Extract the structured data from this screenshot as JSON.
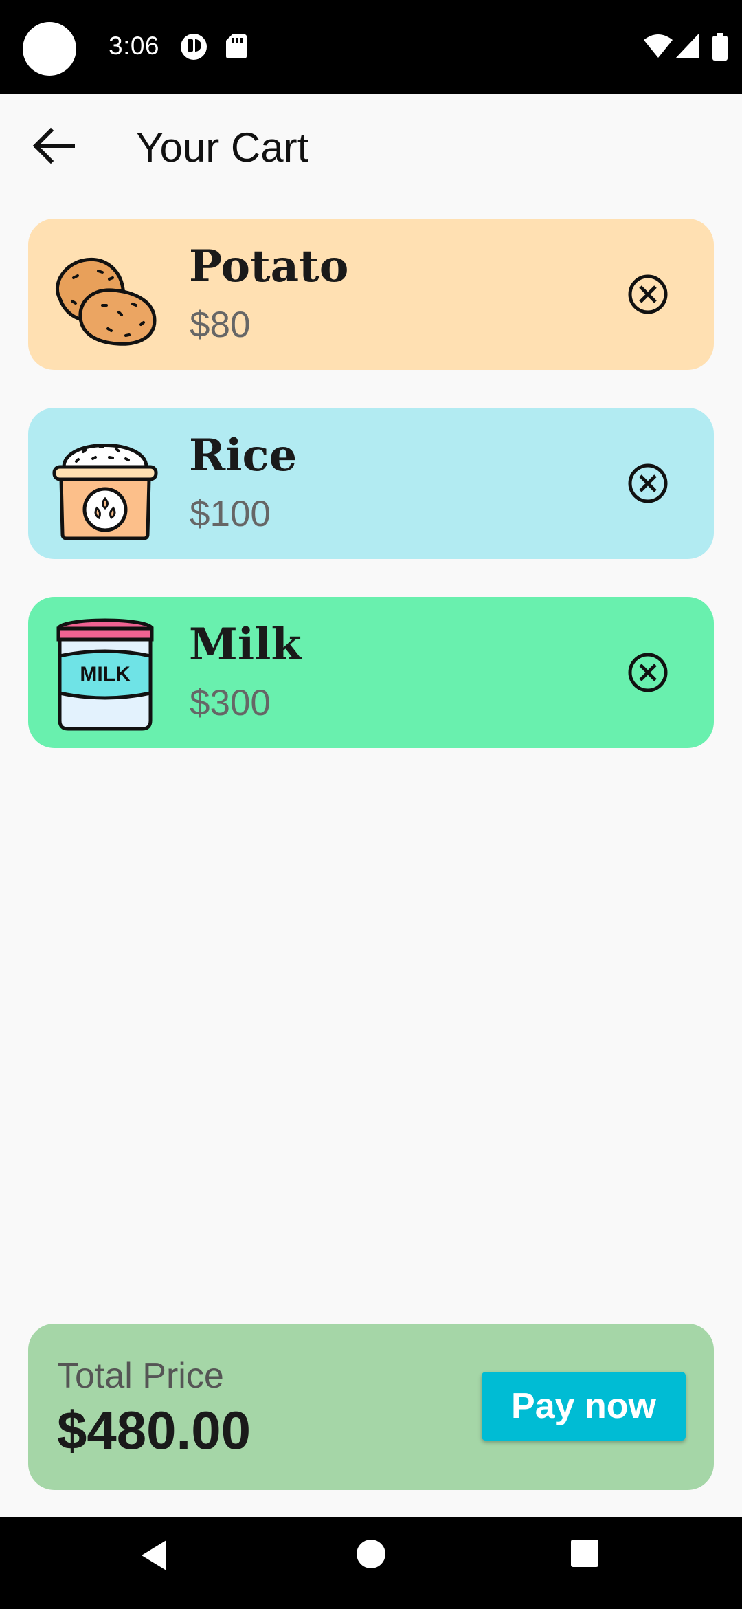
{
  "status_bar": {
    "time": "3:06",
    "icons": [
      "camera-cutout",
      "notification-icon",
      "sd-card-icon",
      "wifi-icon",
      "signal-icon",
      "battery-icon"
    ]
  },
  "app_bar": {
    "back_icon": "arrow-left-icon",
    "title": "Your Cart"
  },
  "cart": {
    "items": [
      {
        "name": "Potato",
        "price": "$80",
        "image": "potato-icon",
        "bg_color": "#ffe0b2",
        "remove_icon": "close-circle-icon"
      },
      {
        "name": "Rice",
        "price": "$100",
        "image": "rice-sack-icon",
        "bg_color": "#b2ebf2",
        "remove_icon": "close-circle-icon"
      },
      {
        "name": "Milk",
        "price": "$300",
        "image": "milk-can-icon",
        "image_text": "MILK",
        "bg_color": "#69f0ae",
        "remove_icon": "close-circle-icon"
      }
    ]
  },
  "summary": {
    "total_label": "Total Price",
    "total_value": "$480.00",
    "pay_button": "Pay now",
    "bg_color": "#a5d6a7",
    "button_color": "#00bcd4"
  },
  "nav_bar": {
    "buttons": [
      "back-triangle-icon",
      "home-circle-icon",
      "recents-square-icon"
    ]
  }
}
